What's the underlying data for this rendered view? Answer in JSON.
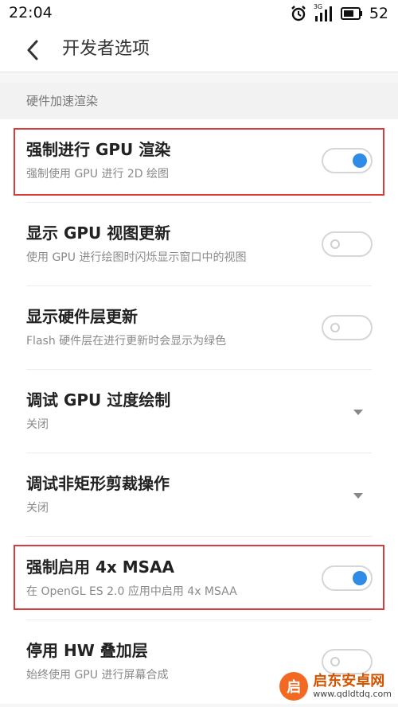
{
  "status_bar": {
    "time": "22:04",
    "battery": "52",
    "network": "3G"
  },
  "header": {
    "title": "开发者选项"
  },
  "section": {
    "title": "硬件加速渲染"
  },
  "settings": [
    {
      "title": "强制进行 GPU 渲染",
      "subtitle": "强制使用 GPU 进行 2D 绘图",
      "control": "toggle",
      "state": "on"
    },
    {
      "title": "显示 GPU 视图更新",
      "subtitle": "使用 GPU 进行绘图时闪烁显示窗口中的视图",
      "control": "toggle",
      "state": "off"
    },
    {
      "title": "显示硬件层更新",
      "subtitle": "Flash 硬件层在进行更新时会显示为绿色",
      "control": "toggle",
      "state": "off"
    },
    {
      "title": "调试 GPU 过度绘制",
      "subtitle": "关闭",
      "control": "dropdown"
    },
    {
      "title": "调试非矩形剪裁操作",
      "subtitle": "关闭",
      "control": "dropdown"
    },
    {
      "title": "强制启用 4x MSAA",
      "subtitle": "在 OpenGL ES 2.0 应用中启用 4x MSAA",
      "control": "toggle",
      "state": "on"
    },
    {
      "title": "停用 HW 叠加层",
      "subtitle": "始终使用 GPU 进行屏幕合成",
      "control": "toggle",
      "state": "off"
    }
  ],
  "colors": {
    "accent": "#2e8ce6",
    "highlight": "#d63c3c"
  },
  "watermark": {
    "logo_glyph": "启",
    "name": "启东安卓网",
    "url": "www.qdldtdq.com"
  }
}
